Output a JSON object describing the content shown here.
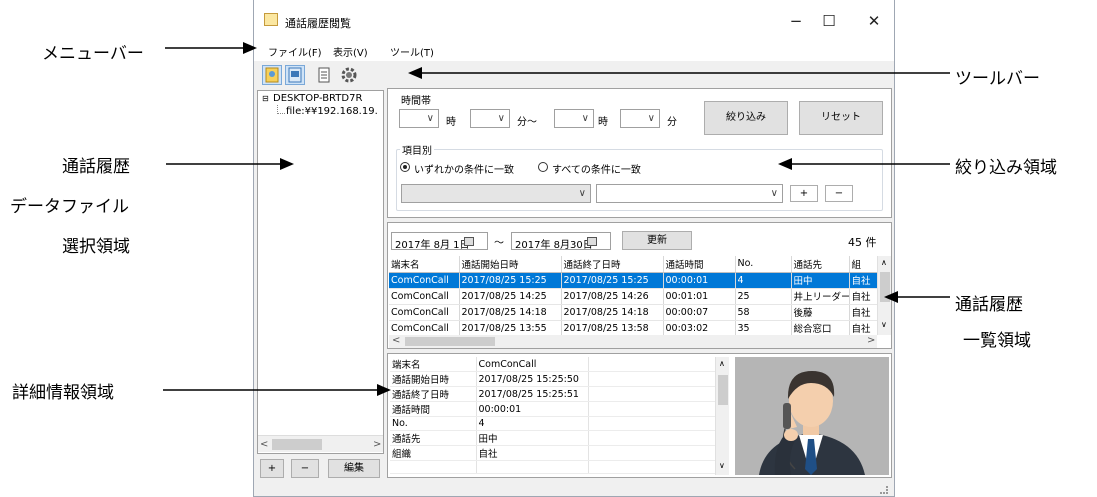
{
  "window": {
    "title": "通話履歴閲覧",
    "minimize": "−",
    "maximize": "☐",
    "close": "✕"
  },
  "menu": [
    "ファイル(F)",
    "表示(V)",
    "ツール(T)"
  ],
  "tree": {
    "root_toggle": "⊟",
    "root": "DESKTOP-BRTD7R",
    "child": "file:¥¥192.168.19."
  },
  "left_buttons": {
    "add": "+",
    "remove": "−",
    "edit": "編集"
  },
  "filter": {
    "time_group": "時間帯",
    "hour_label": "時",
    "minute_tilde": "分〜",
    "hour2_label": "時",
    "minute2_label": "分",
    "narrow_button": "絞り込み",
    "reset_button": "リセット",
    "item_group": "項目別",
    "radio_any": "いずれかの条件に一致",
    "radio_all": "すべての条件に一致",
    "plus": "+",
    "minus": "−",
    "dropdown_arrow": "∨"
  },
  "date": {
    "from": "2017年  8月  1日",
    "tilde": "〜",
    "to": "2017年  8月30日",
    "refresh": "更新",
    "count": "45 件"
  },
  "list": {
    "headers": [
      "端末名",
      "通話開始日時",
      "通話終了日時",
      "通話時間",
      "No.",
      "通話先",
      "組"
    ],
    "rows": [
      [
        "ComConCall",
        "2017/08/25 15:25",
        "2017/08/25 15:25",
        "00:00:01",
        "4",
        "田中",
        "自社"
      ],
      [
        "ComConCall",
        "2017/08/25 14:25",
        "2017/08/25 14:26",
        "00:01:01",
        "25",
        "井上リーダー",
        "自社"
      ],
      [
        "ComConCall",
        "2017/08/25 14:18",
        "2017/08/25 14:18",
        "00:00:07",
        "58",
        "後藤",
        "自社"
      ],
      [
        "ComConCall",
        "2017/08/25 13:55",
        "2017/08/25 13:58",
        "00:03:02",
        "35",
        "総合窓口",
        "自社"
      ]
    ]
  },
  "detail": [
    [
      "端末名",
      "ComConCall"
    ],
    [
      "通話開始日時",
      "2017/08/25 15:25:50"
    ],
    [
      "通話終了日時",
      "2017/08/25 15:25:51"
    ],
    [
      "通話時間",
      "00:00:01"
    ],
    [
      "No.",
      "4"
    ],
    [
      "通話先",
      "田中"
    ],
    [
      "組織",
      "自社"
    ],
    [
      "",
      ""
    ]
  ],
  "callouts": {
    "menubar": "メニューバー",
    "tree1": "通話履歴",
    "tree2": "データファイル",
    "tree3": "選択領域",
    "detail": "詳細情報領域",
    "toolbar": "ツールバー",
    "filter": "絞り込み領域",
    "list1": "通話履歴",
    "list2": "一覧領域"
  }
}
